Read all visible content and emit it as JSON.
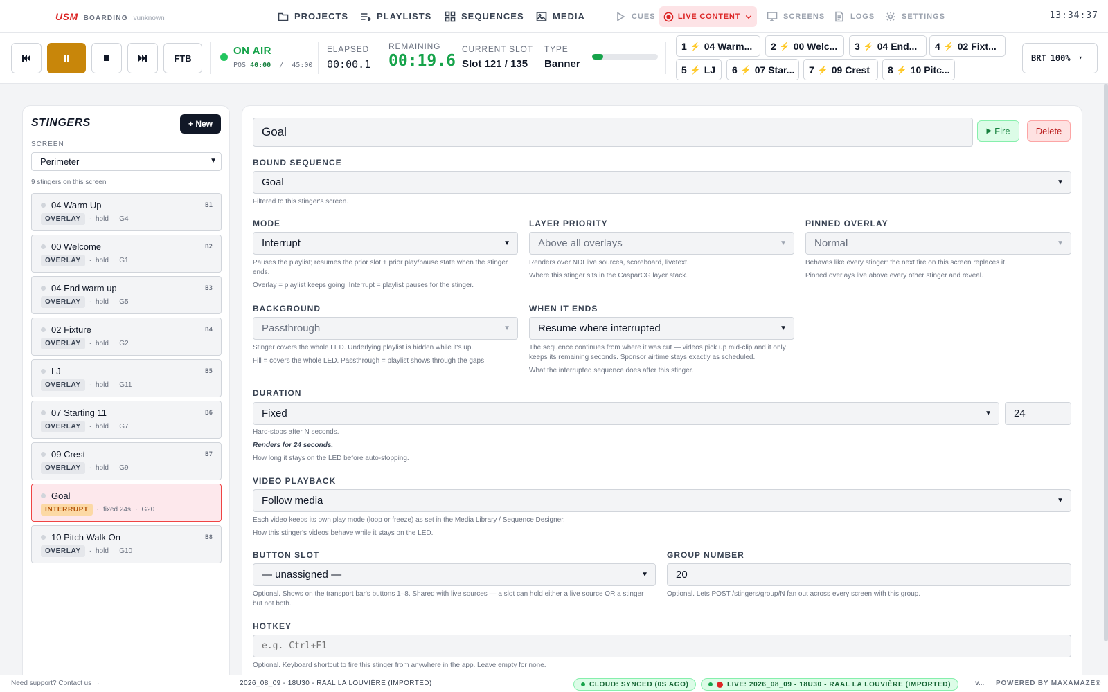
{
  "nav": {
    "logo": "USM",
    "app": "BOARDING",
    "user": "vunknown",
    "items": [
      {
        "label": "PROJECTS",
        "icon": "folder-icon"
      },
      {
        "label": "PLAYLISTS",
        "icon": "playlist-icon"
      },
      {
        "label": "SEQUENCES",
        "icon": "grid-icon"
      },
      {
        "label": "MEDIA",
        "icon": "image-icon"
      },
      {
        "label": "CUES",
        "icon": "play-outline-icon"
      },
      {
        "label": "LIVE CONTENT",
        "icon": "record-icon"
      },
      {
        "label": "SCREENS",
        "icon": "monitor-icon"
      },
      {
        "label": "LOGS",
        "icon": "document-icon"
      },
      {
        "label": "SETTINGS",
        "icon": "gear-icon"
      }
    ],
    "clock": "13:34:37"
  },
  "transport": {
    "ftb_label": "FTB",
    "onair_label": "ON AIR",
    "pos_label": "POS",
    "pos_value": "40:00",
    "pos_sep": "/",
    "pos_total": "45:00",
    "elapsed_label": "ELAPSED",
    "elapsed_value": "00:00.1",
    "remaining_label": "REMAINING",
    "remaining_value": "00:19.6",
    "slot_label": "CURRENT SLOT",
    "slot_value": "Slot 121 / 135",
    "type_label": "TYPE",
    "type_value": "Banner",
    "progress": 0.17,
    "slots": [
      {
        "num": "1",
        "name": "04 Warm..."
      },
      {
        "num": "2",
        "name": "00 Welc..."
      },
      {
        "num": "3",
        "name": "04 End..."
      },
      {
        "num": "4",
        "name": "02 Fixt..."
      },
      {
        "num": "5",
        "name": "LJ"
      },
      {
        "num": "6",
        "name": "07 Star..."
      },
      {
        "num": "7",
        "name": "09 Crest"
      },
      {
        "num": "8",
        "name": "10 Pitc..."
      }
    ],
    "brt_label": "BRT",
    "brt_value": "100%"
  },
  "stingers": {
    "title": "STINGERS",
    "new_label": "+ New",
    "screen_label": "SCREEN",
    "screen_value": "Perimeter",
    "count_text": "9 stingers on this screen",
    "items": [
      {
        "name": "04 Warm Up",
        "key": "B1",
        "badge": "OVERLAY",
        "mode": "hold",
        "group": "G4"
      },
      {
        "name": "00 Welcome",
        "key": "B2",
        "badge": "OVERLAY",
        "mode": "hold",
        "group": "G1"
      },
      {
        "name": "04 End warm up",
        "key": "B3",
        "badge": "OVERLAY",
        "mode": "hold",
        "group": "G5"
      },
      {
        "name": "02 Fixture",
        "key": "B4",
        "badge": "OVERLAY",
        "mode": "hold",
        "group": "G2"
      },
      {
        "name": "LJ",
        "key": "B5",
        "badge": "OVERLAY",
        "mode": "hold",
        "group": "G11"
      },
      {
        "name": "07 Starting 11",
        "key": "B6",
        "badge": "OVERLAY",
        "mode": "hold",
        "group": "G7"
      },
      {
        "name": "09 Crest",
        "key": "B7",
        "badge": "OVERLAY",
        "mode": "hold",
        "group": "G9"
      },
      {
        "name": "Goal",
        "key": "",
        "badge": "INTERRUPT",
        "mode": "fixed 24s",
        "group": "G20"
      },
      {
        "name": "10 Pitch Walk On",
        "key": "B8",
        "badge": "OVERLAY",
        "mode": "hold",
        "group": "G10"
      }
    ],
    "sep": "·"
  },
  "editor": {
    "name": "Goal",
    "fire_label": "Fire",
    "delete_label": "Delete",
    "bound_sequence": {
      "label": "BOUND SEQUENCE",
      "value": "Goal",
      "help": "Filtered to this stinger's screen."
    },
    "mode": {
      "label": "MODE",
      "value": "Interrupt",
      "help1": "Pauses the playlist; resumes the prior slot + prior play/pause state when the stinger ends.",
      "help2": "Overlay = playlist keeps going. Interrupt = playlist pauses for the stinger."
    },
    "layer_priority": {
      "label": "LAYER PRIORITY",
      "value": "Above all overlays",
      "help1": "Renders over NDI live sources, scoreboard, livetext.",
      "help2": "Where this stinger sits in the CasparCG layer stack."
    },
    "pinned_overlay": {
      "label": "PINNED OVERLAY",
      "value": "Normal",
      "help1": "Behaves like every stinger: the next fire on this screen replaces it.",
      "help2": "Pinned overlays live above every other stinger and reveal."
    },
    "background": {
      "label": "BACKGROUND",
      "value": "Passthrough",
      "help1": "Stinger covers the whole LED. Underlying playlist is hidden while it's up.",
      "help2": "Fill = covers the whole LED. Passthrough = playlist shows through the gaps."
    },
    "when_ends": {
      "label": "WHEN IT ENDS",
      "value": "Resume where interrupted",
      "help1": "The sequence continues from where it was cut — videos pick up mid-clip and it only keeps its remaining seconds. Sponsor airtime stays exactly as scheduled.",
      "help2": "What the interrupted sequence does after this stinger."
    },
    "duration": {
      "label": "DURATION",
      "value": "Fixed",
      "seconds": "24",
      "help1": "Hard-stops after N seconds.",
      "help2": "Renders for 24 seconds.",
      "help3": "How long it stays on the LED before auto-stopping."
    },
    "video_playback": {
      "label": "VIDEO PLAYBACK",
      "value": "Follow media",
      "help1": "Each video keeps its own play mode (loop or freeze) as set in the Media Library / Sequence Designer.",
      "help2": "How this stinger's videos behave while it stays on the LED."
    },
    "button_slot": {
      "label": "BUTTON SLOT",
      "value": "— unassigned —",
      "help": "Optional. Shows on the transport bar's buttons 1–8. Shared with live sources — a slot can hold either a live source OR a stinger but not both."
    },
    "group_number": {
      "label": "GROUP NUMBER",
      "value": "20",
      "help": "Optional. Lets POST /stingers/group/N fan out across every screen with this group."
    },
    "hotkey": {
      "label": "HOTKEY",
      "placeholder": "e.g. Ctrl+F1",
      "help": "Optional. Keyboard shortcut to fire this stinger from anywhere in the app. Leave empty for none."
    }
  },
  "footer": {
    "support": "Need support? Contact us →",
    "project": "2026_08_09 - 18U30 - RAAL LA LOUVIÈRE (IMPORTED)",
    "cloud": "CLOUD: SYNCED (0S AGO)",
    "live": "LIVE: 2026_08_09 - 18U30 - RAAL LA LOUVIÈRE (IMPORTED)",
    "version": "v...",
    "powered": "POWERED BY MAXAMAZE®"
  }
}
